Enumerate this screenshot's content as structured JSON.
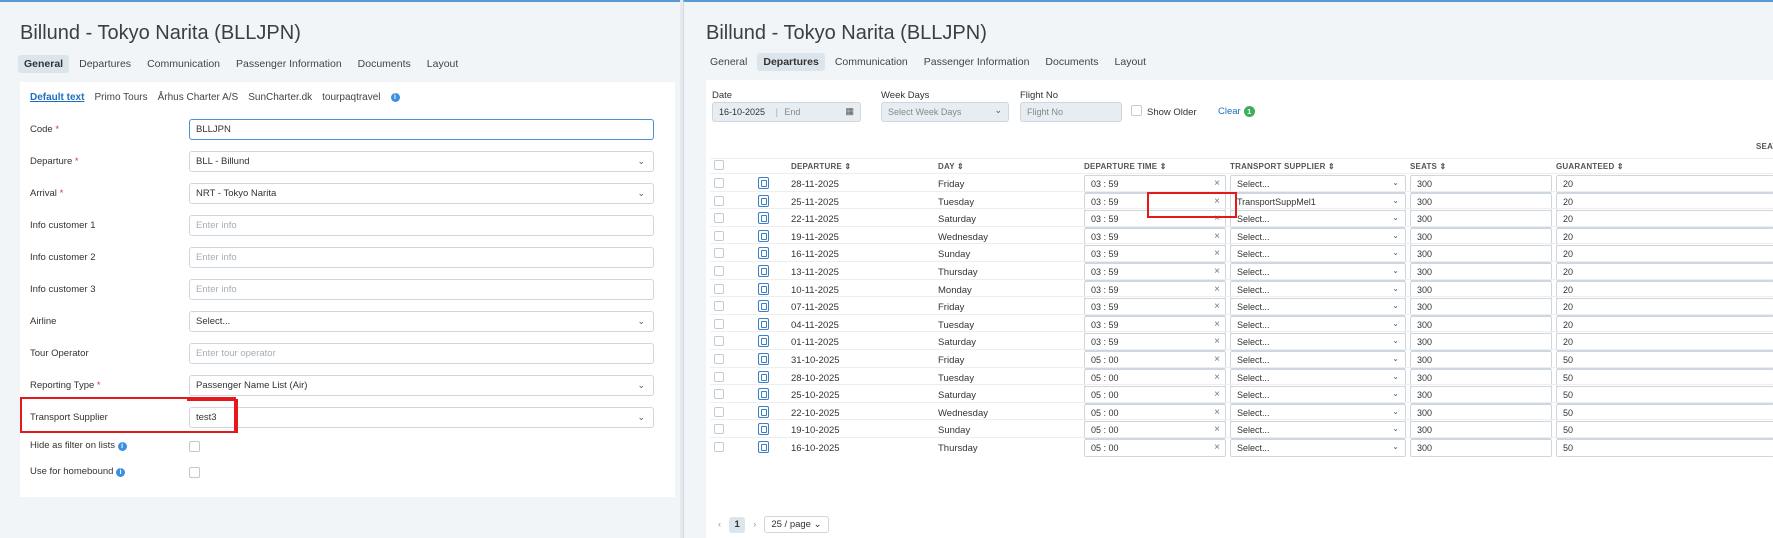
{
  "left": {
    "title": "Billund - Tokyo Narita (BLLJPN)",
    "tabs": [
      "General",
      "Departures",
      "Communication",
      "Passenger Information",
      "Documents",
      "Layout"
    ],
    "active_tab": "General",
    "subtabs": [
      "Default text",
      "Primo Tours",
      "Århus Charter A/S",
      "SunCharter.dk",
      "tourpaqtravel"
    ],
    "fields": {
      "code": {
        "label": "Code",
        "value": "BLLJPN"
      },
      "departure": {
        "label": "Departure",
        "value": "BLL - Billund"
      },
      "arrival": {
        "label": "Arrival",
        "value": "NRT - Tokyo Narita"
      },
      "info1": {
        "label": "Info customer 1",
        "placeholder": "Enter info"
      },
      "info2": {
        "label": "Info customer 2",
        "placeholder": "Enter info"
      },
      "info3": {
        "label": "Info customer 3",
        "placeholder": "Enter info"
      },
      "airline": {
        "label": "Airline",
        "value": "Select..."
      },
      "tour_operator": {
        "label": "Tour Operator",
        "placeholder": "Enter tour operator"
      },
      "reporting_type": {
        "label": "Reporting Type",
        "value": "Passenger Name List (Air)"
      },
      "transport_supplier": {
        "label": "Transport Supplier",
        "value": "test3"
      },
      "hide_filter": {
        "label": "Hide as filter on lists"
      },
      "homebound": {
        "label": "Use for homebound"
      }
    },
    "required_mark": "*"
  },
  "right": {
    "title": "Billund - Tokyo Narita (BLLJPN)",
    "tabs": [
      "General",
      "Departures",
      "Communication",
      "Passenger Information",
      "Documents",
      "Layout"
    ],
    "active_tab": "Departures",
    "filters": {
      "date_label": "Date",
      "date_start": "16-10-2025",
      "date_end_placeholder": "End",
      "weekdays_label": "Week Days",
      "weekdays_placeholder": "Select Week Days",
      "flightno_label": "Flight No",
      "flightno_placeholder": "Flight No",
      "show_older": "Show Older",
      "clear": "Clear",
      "clear_count": "1"
    },
    "columns": {
      "departure": "DEPARTURE ⇕",
      "day": "DAY ⇕",
      "departure_time": "DEPARTURE TIME ⇕",
      "transport_supplier": "TRANSPORT SUPPLIER ⇕",
      "seats": "SEATS ⇕",
      "guaranteed": "GUARANTEED ⇕",
      "group_header": "SEATS"
    },
    "rows": [
      {
        "date": "28-11-2025",
        "day": "Friday",
        "time": "03 : 59",
        "supplier": "Select...",
        "seats": "300",
        "guaranteed": "20"
      },
      {
        "date": "25-11-2025",
        "day": "Tuesday",
        "time": "03 : 59",
        "supplier": "TransportSuppMel1",
        "seats": "300",
        "guaranteed": "20"
      },
      {
        "date": "22-11-2025",
        "day": "Saturday",
        "time": "03 : 59",
        "supplier": "Select...",
        "seats": "300",
        "guaranteed": "20"
      },
      {
        "date": "19-11-2025",
        "day": "Wednesday",
        "time": "03 : 59",
        "supplier": "Select...",
        "seats": "300",
        "guaranteed": "20"
      },
      {
        "date": "16-11-2025",
        "day": "Sunday",
        "time": "03 : 59",
        "supplier": "Select...",
        "seats": "300",
        "guaranteed": "20"
      },
      {
        "date": "13-11-2025",
        "day": "Thursday",
        "time": "03 : 59",
        "supplier": "Select...",
        "seats": "300",
        "guaranteed": "20"
      },
      {
        "date": "10-11-2025",
        "day": "Monday",
        "time": "03 : 59",
        "supplier": "Select...",
        "seats": "300",
        "guaranteed": "20"
      },
      {
        "date": "07-11-2025",
        "day": "Friday",
        "time": "03 : 59",
        "supplier": "Select...",
        "seats": "300",
        "guaranteed": "20"
      },
      {
        "date": "04-11-2025",
        "day": "Tuesday",
        "time": "03 : 59",
        "supplier": "Select...",
        "seats": "300",
        "guaranteed": "20"
      },
      {
        "date": "01-11-2025",
        "day": "Saturday",
        "time": "03 : 59",
        "supplier": "Select...",
        "seats": "300",
        "guaranteed": "20"
      },
      {
        "date": "31-10-2025",
        "day": "Friday",
        "time": "05 : 00",
        "supplier": "Select...",
        "seats": "300",
        "guaranteed": "50"
      },
      {
        "date": "28-10-2025",
        "day": "Tuesday",
        "time": "05 : 00",
        "supplier": "Select...",
        "seats": "300",
        "guaranteed": "50"
      },
      {
        "date": "25-10-2025",
        "day": "Saturday",
        "time": "05 : 00",
        "supplier": "Select...",
        "seats": "300",
        "guaranteed": "50"
      },
      {
        "date": "22-10-2025",
        "day": "Wednesday",
        "time": "05 : 00",
        "supplier": "Select...",
        "seats": "300",
        "guaranteed": "50"
      },
      {
        "date": "19-10-2025",
        "day": "Sunday",
        "time": "05 : 00",
        "supplier": "Select...",
        "seats": "300",
        "guaranteed": "50"
      },
      {
        "date": "16-10-2025",
        "day": "Thursday",
        "time": "05 : 00",
        "supplier": "Select...",
        "seats": "300",
        "guaranteed": "50"
      }
    ],
    "pager": {
      "prev": "‹",
      "current": "1",
      "next": "›",
      "page_size": "25 / page"
    }
  },
  "colors": {
    "accent": "#1f6fc2",
    "highlight": "#e3191c",
    "badge": "#3fae5a"
  }
}
